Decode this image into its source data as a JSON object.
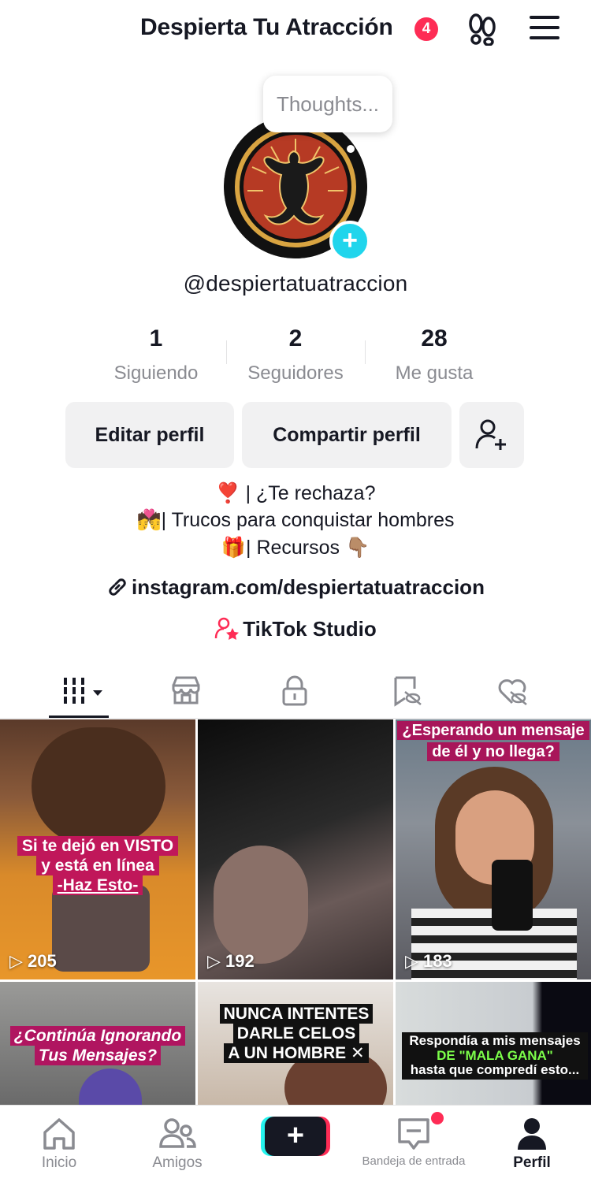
{
  "header": {
    "title": "Despierta Tu Atracción",
    "badge_count": "4",
    "footprint_icon": "footprint-icon",
    "menu_icon": "hamburger-menu-icon"
  },
  "profile": {
    "note_bubble": "Thoughts...",
    "username": "@despiertatuatraccion",
    "stats": [
      {
        "value": "1",
        "label": "Siguiendo"
      },
      {
        "value": "2",
        "label": "Seguidores"
      },
      {
        "value": "28",
        "label": "Me gusta"
      }
    ],
    "buttons": {
      "edit": "Editar perfil",
      "share": "Compartir perfil",
      "add_friend_icon": "add-user-icon"
    },
    "bio": [
      "❣️ | ¿Te rechaza?",
      "💏| Trucos para conquistar hombres",
      "🎁| Recursos 👇🏽"
    ],
    "link": "instagram.com/despiertatuatraccion",
    "studio": "TikTok Studio"
  },
  "tabs": [
    {
      "icon": "videos-grid-icon",
      "active": true
    },
    {
      "icon": "shop-icon"
    },
    {
      "icon": "lock-icon"
    },
    {
      "icon": "bookmark-icon"
    },
    {
      "icon": "liked-heart-icon"
    }
  ],
  "videos": [
    {
      "views": "205",
      "caption": [
        "Si te dejó en VISTO",
        "y está en línea",
        "-Haz Esto-"
      ]
    },
    {
      "views": "192",
      "caption": []
    },
    {
      "views": "183",
      "caption": [
        "¿Esperando un mensaje",
        "de él y no llega?"
      ]
    },
    {
      "views": "",
      "caption": [
        "¿Continúa Ignorando",
        "Tus Mensajes?"
      ]
    },
    {
      "views": "",
      "caption": [
        "NUNCA INTENTES",
        "DARLE CELOS",
        "A UN HOMBRE ✕"
      ]
    },
    {
      "views": "",
      "caption": [
        "Respondía a mis mensajes",
        "DE \"MALA GANA\"",
        "hasta que compredí esto..."
      ]
    }
  ],
  "bottom_nav": {
    "home": "Inicio",
    "friends": "Amigos",
    "create": "+",
    "inbox": "Bandeja de entrada",
    "profile": "Perfil"
  },
  "colors": {
    "accent_red": "#fe2c55",
    "accent_cyan": "#20d5ec",
    "text_primary": "#161823",
    "text_secondary": "#8a8b91",
    "button_bg": "#f1f1f2"
  }
}
